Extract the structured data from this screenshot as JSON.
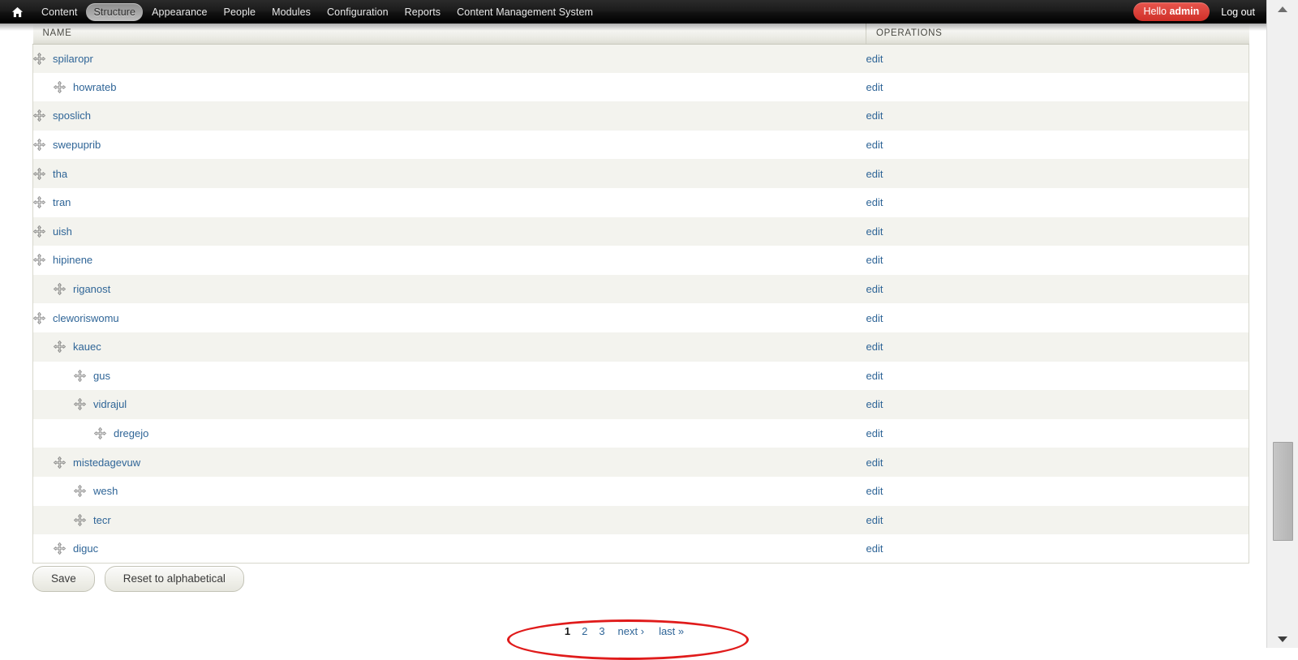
{
  "toolbar": {
    "home_icon": "home-icon",
    "menu": [
      {
        "label": "Content",
        "active": false
      },
      {
        "label": "Structure",
        "active": true
      },
      {
        "label": "Appearance",
        "active": false
      },
      {
        "label": "People",
        "active": false
      },
      {
        "label": "Modules",
        "active": false
      },
      {
        "label": "Configuration",
        "active": false
      },
      {
        "label": "Reports",
        "active": false
      },
      {
        "label": "Content Management System",
        "active": false
      }
    ],
    "greeting_prefix": "Hello ",
    "greeting_user": "admin",
    "logout_label": "Log out"
  },
  "table": {
    "columns": {
      "name": "NAME",
      "operations": "OPERATIONS"
    },
    "operation_label": "edit",
    "drag_icon": "drag-move-icon",
    "rows": [
      {
        "name": "spilaropr",
        "depth": 0
      },
      {
        "name": "howrateb",
        "depth": 1
      },
      {
        "name": "sposlich",
        "depth": 0
      },
      {
        "name": "swepuprib",
        "depth": 0
      },
      {
        "name": "tha",
        "depth": 0
      },
      {
        "name": "tran",
        "depth": 0
      },
      {
        "name": "uish",
        "depth": 0
      },
      {
        "name": "hipinene",
        "depth": 0
      },
      {
        "name": "riganost",
        "depth": 1
      },
      {
        "name": "cleworiswomu",
        "depth": 0
      },
      {
        "name": "kauec",
        "depth": 1
      },
      {
        "name": "gus",
        "depth": 2
      },
      {
        "name": "vidrajul",
        "depth": 2
      },
      {
        "name": "dregejo",
        "depth": 3
      },
      {
        "name": "mistedagevuw",
        "depth": 1
      },
      {
        "name": "wesh",
        "depth": 2
      },
      {
        "name": "tecr",
        "depth": 2
      },
      {
        "name": "diguc",
        "depth": 1
      }
    ]
  },
  "actions": {
    "save_label": "Save",
    "reset_label": "Reset to alphabetical"
  },
  "pager": {
    "items": [
      {
        "label": "1",
        "current": true,
        "wide": false
      },
      {
        "label": "2",
        "current": false,
        "wide": false
      },
      {
        "label": "3",
        "current": false,
        "wide": false
      },
      {
        "label": "next ›",
        "current": false,
        "wide": true
      },
      {
        "label": "last »",
        "current": false,
        "wide": true
      }
    ],
    "annotation_color": "#e01b1b"
  },
  "scrollbar": {
    "up_icon": "scroll-up-arrow-icon",
    "down_icon": "scroll-down-arrow-icon"
  },
  "colors": {
    "link": "#2f6597",
    "toolbar_bg": "#111111",
    "accent_red": "#cf2f28",
    "row_odd": "#f3f3ee",
    "row_even": "#ffffff"
  }
}
